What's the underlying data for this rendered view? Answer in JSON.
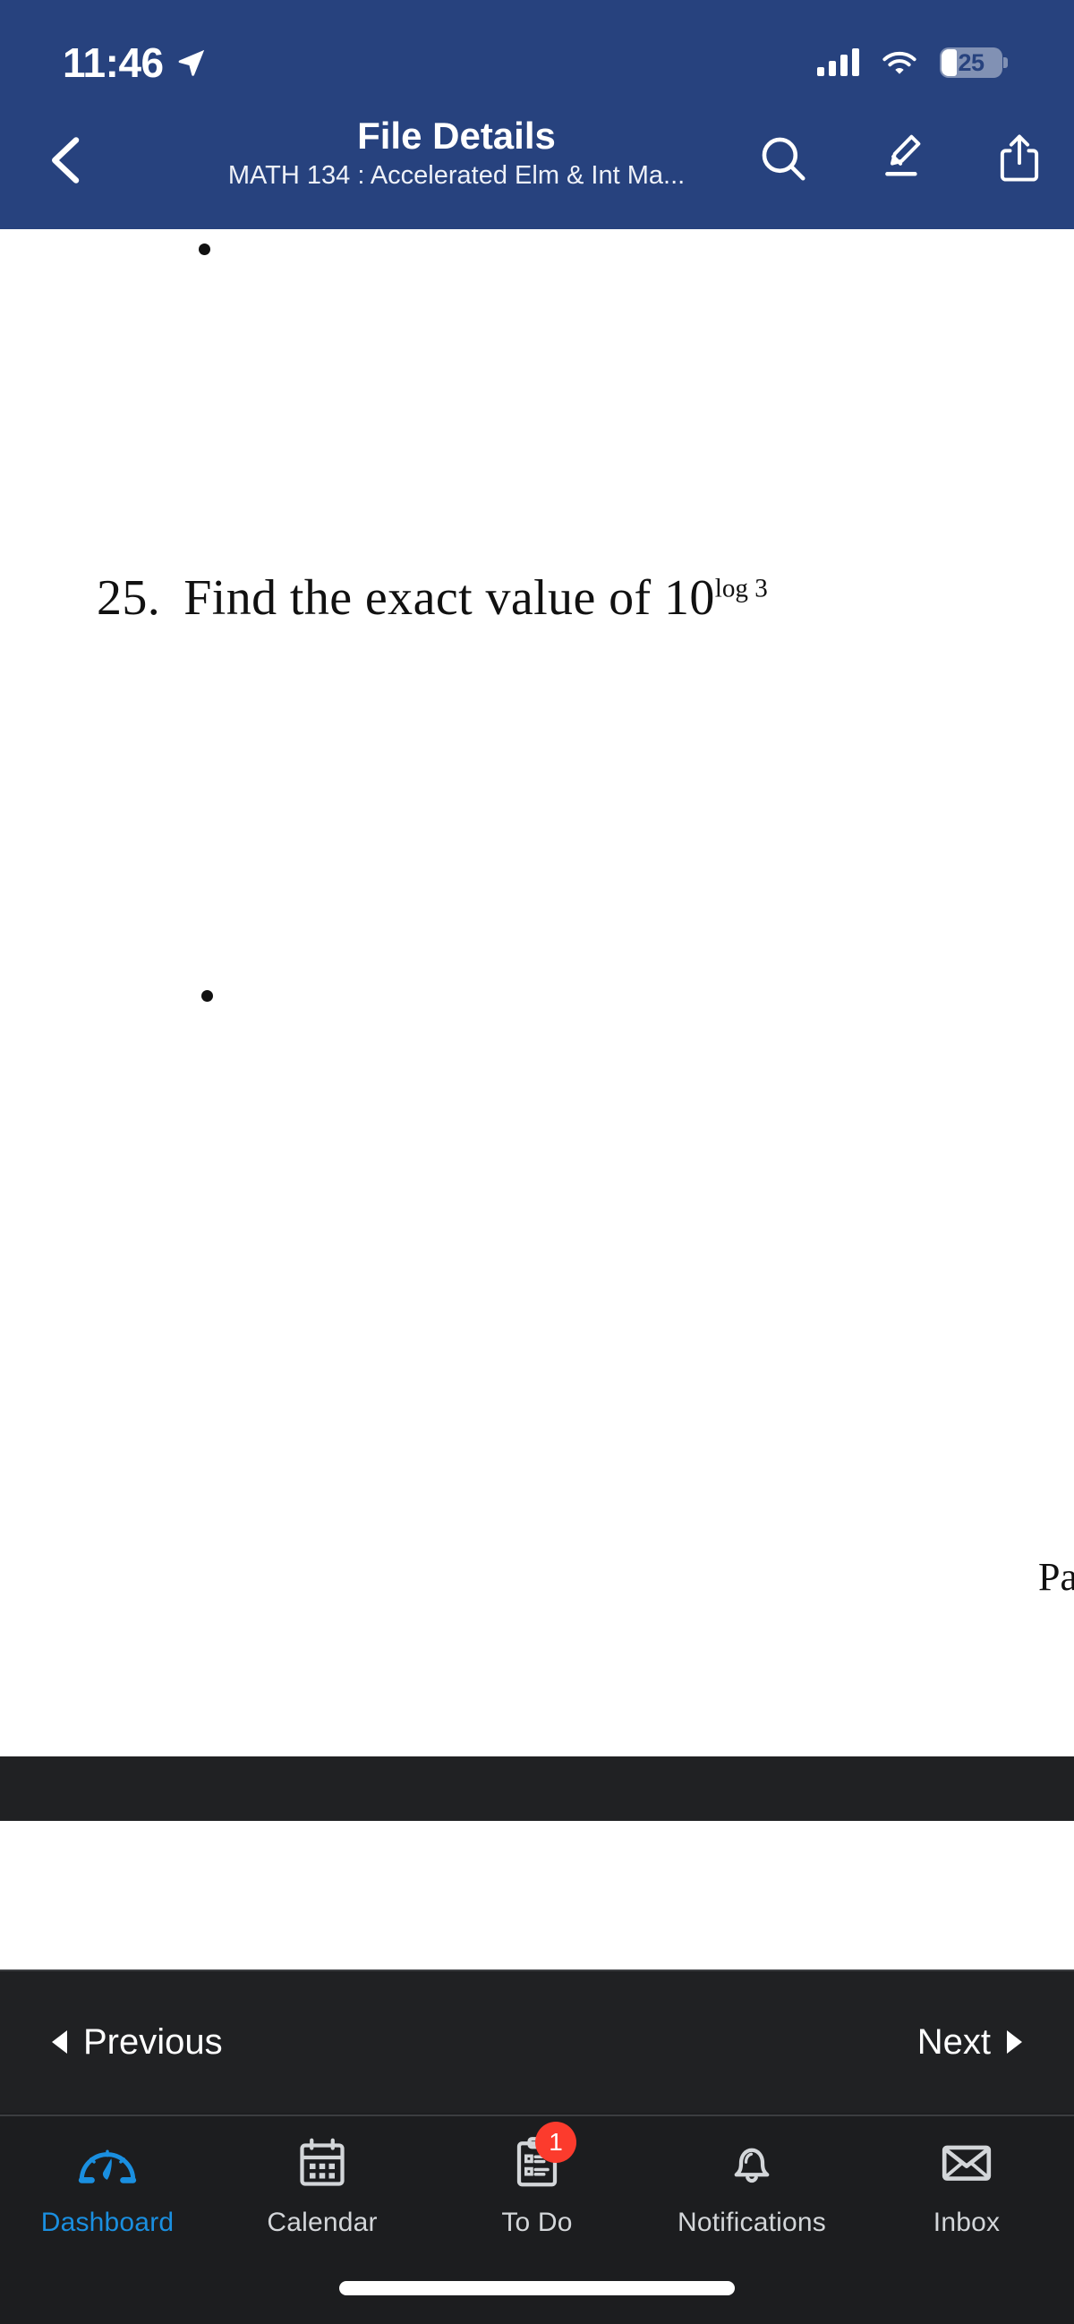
{
  "status_bar": {
    "time": "11:46",
    "location_icon": "location-arrow-icon",
    "signal_icon": "cellular-signal-icon",
    "wifi_icon": "wifi-icon",
    "battery_percent": "25",
    "battery_icon": "battery-icon"
  },
  "nav_bar": {
    "back_icon": "chevron-left-icon",
    "title": "File Details",
    "subtitle": "MATH 134 : Accelerated Elm & Int Ma...",
    "actions": [
      {
        "name": "search-icon",
        "label": "Search"
      },
      {
        "name": "highlighter-icon",
        "label": "Annotate"
      },
      {
        "name": "share-icon",
        "label": "Share"
      }
    ],
    "accent_color": "#27427E"
  },
  "document": {
    "question_number": "25.",
    "question_text": "Find the exact value of 10",
    "exponent": "log 3",
    "page_label_partial": "Pa",
    "background_color": "#ffffff",
    "gap_color": "#202123"
  },
  "pager": {
    "previous_label": "Previous",
    "previous_icon": "triangle-left-icon",
    "next_label": "Next",
    "next_icon": "triangle-right-icon",
    "background_color": "#202123"
  },
  "tab_bar": {
    "active_color": "#1a8fe0",
    "inactive_color": "#d3d6d9",
    "badge_color": "#FC3B2D",
    "tabs": [
      {
        "label": "Dashboard",
        "icon": "dashboard-gauge-icon",
        "active": true,
        "badge": ""
      },
      {
        "label": "Calendar",
        "icon": "calendar-icon",
        "active": false,
        "badge": ""
      },
      {
        "label": "To Do",
        "icon": "clipboard-list-icon",
        "active": false,
        "badge": "1"
      },
      {
        "label": "Notifications",
        "icon": "bell-icon",
        "active": false,
        "badge": ""
      },
      {
        "label": "Inbox",
        "icon": "envelope-icon",
        "active": false,
        "badge": ""
      }
    ]
  },
  "home_indicator": {
    "name": "home-indicator"
  }
}
